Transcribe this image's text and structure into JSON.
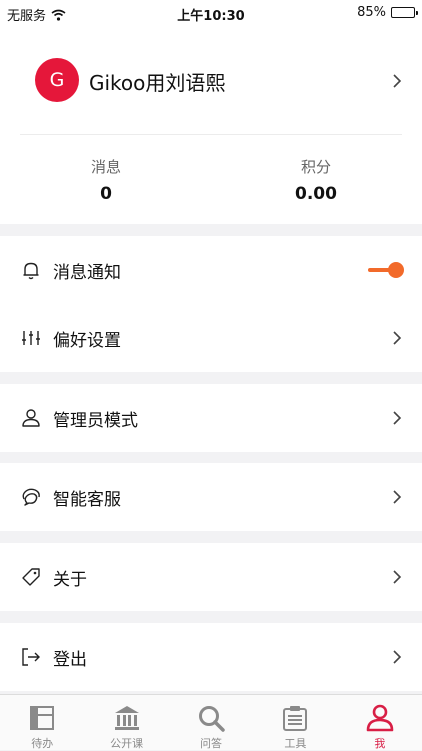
{
  "status_bar": {
    "carrier": "无服务",
    "time": "上午10:30",
    "battery": "85%",
    "battery_level": 0.85
  },
  "profile": {
    "avatar_letter": "G",
    "name": "Gikoo用刘语熙",
    "avatar_color": "#e5173a"
  },
  "stats": [
    {
      "label": "消息",
      "value": "0"
    },
    {
      "label": "积分",
      "value": "0.00"
    }
  ],
  "menu": {
    "notifications": {
      "label": "消息通知",
      "icon": "bell-icon",
      "toggle_on": true
    },
    "preferences": {
      "label": "偏好设置",
      "icon": "sliders-icon"
    },
    "admin_mode": {
      "label": "管理员模式",
      "icon": "person-icon"
    },
    "customer_service": {
      "label": "智能客服",
      "icon": "chat-bubbles-icon"
    },
    "about": {
      "label": "关于",
      "icon": "tag-icon"
    },
    "logout": {
      "label": "登出",
      "icon": "logout-icon"
    }
  },
  "tabbar": [
    {
      "label": "待办",
      "icon": "todo-icon",
      "active": false
    },
    {
      "label": "公开课",
      "icon": "building-icon",
      "active": false
    },
    {
      "label": "问答",
      "icon": "search-icon",
      "active": false
    },
    {
      "label": "工具",
      "icon": "clipboard-icon",
      "active": false
    },
    {
      "label": "我",
      "icon": "person-icon",
      "active": true
    }
  ],
  "colors": {
    "accent": "#d81e45",
    "toggle": "#f26a2a",
    "background": "#f2f2f4"
  }
}
